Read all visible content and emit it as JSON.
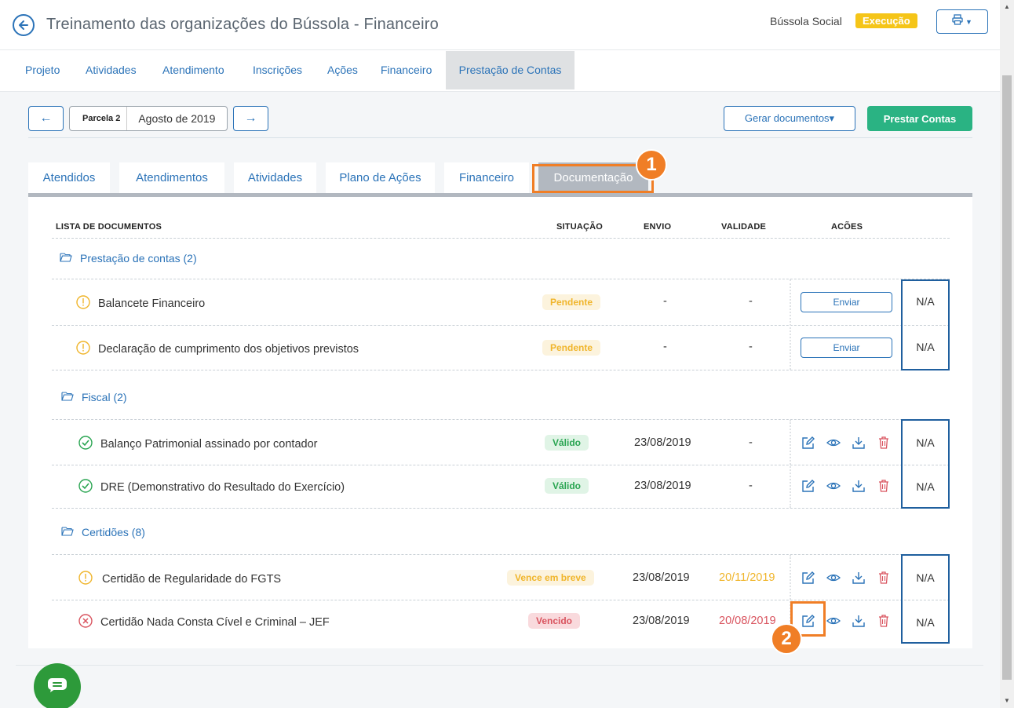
{
  "header": {
    "title": "Treinamento das organizações do Bússola - Financeiro",
    "org": "Bússola Social",
    "status": "Execução"
  },
  "topnav": [
    "Projeto",
    "Atividades",
    "Atendimento",
    "Inscrições",
    "Ações",
    "Financeiro",
    "Prestação de Contas"
  ],
  "toolbar": {
    "prev": "←",
    "next": "→",
    "parcela": "Parcela 2",
    "period": "Agosto de 2019",
    "gerar": "Gerar documentos▾",
    "prestar": "Prestar Contas"
  },
  "subtabs": [
    "Atendidos",
    "Atendimentos",
    "Atividades",
    "Plano de Ações",
    "Financeiro",
    "Documentação"
  ],
  "table": {
    "headers": {
      "list": "LISTA DE DOCUMENTOS",
      "status": "SITUAÇÃO",
      "sent": "ENVIO",
      "validity": "VALIDADE",
      "actions": "ACÕES"
    },
    "groups": [
      {
        "title": "Prestação de contas (2)",
        "rows": [
          {
            "name": "Balancete Financeiro",
            "status": "Pendente",
            "sent": "-",
            "validity": "-",
            "action": "Enviar",
            "extra": "N/A"
          },
          {
            "name": "Declaração de cumprimento dos objetivos previstos",
            "status": "Pendente",
            "sent": "-",
            "validity": "-",
            "action": "Enviar",
            "extra": "N/A"
          }
        ]
      },
      {
        "title": "Fiscal (2)",
        "rows": [
          {
            "name": "Balanço Patrimonial assinado por contador",
            "status": "Válido",
            "sent": "23/08/2019",
            "validity": "-",
            "extra": "N/A"
          },
          {
            "name": "DRE (Demonstrativo do Resultado do Exercício)",
            "status": "Válido",
            "sent": "23/08/2019",
            "validity": "-",
            "extra": "N/A"
          }
        ]
      },
      {
        "title": "Certidões (8)",
        "rows": [
          {
            "name": "Certidão de Regularidade do FGTS",
            "status": "Vence em breve",
            "sent": "23/08/2019",
            "validity": "20/11/2019",
            "extra": "N/A"
          },
          {
            "name": "Certidão Nada Consta Cível e Criminal – JEF",
            "status": "Vencido",
            "sent": "23/08/2019",
            "validity": "20/08/2019",
            "extra": "N/A"
          }
        ]
      }
    ]
  },
  "annotations": {
    "one": "1",
    "two": "2"
  },
  "colors": {
    "primary": "#2b73b8",
    "success": "#2ab383",
    "warning": "#f5c518",
    "highlight": "#f07e26",
    "danger": "#d9545f"
  }
}
